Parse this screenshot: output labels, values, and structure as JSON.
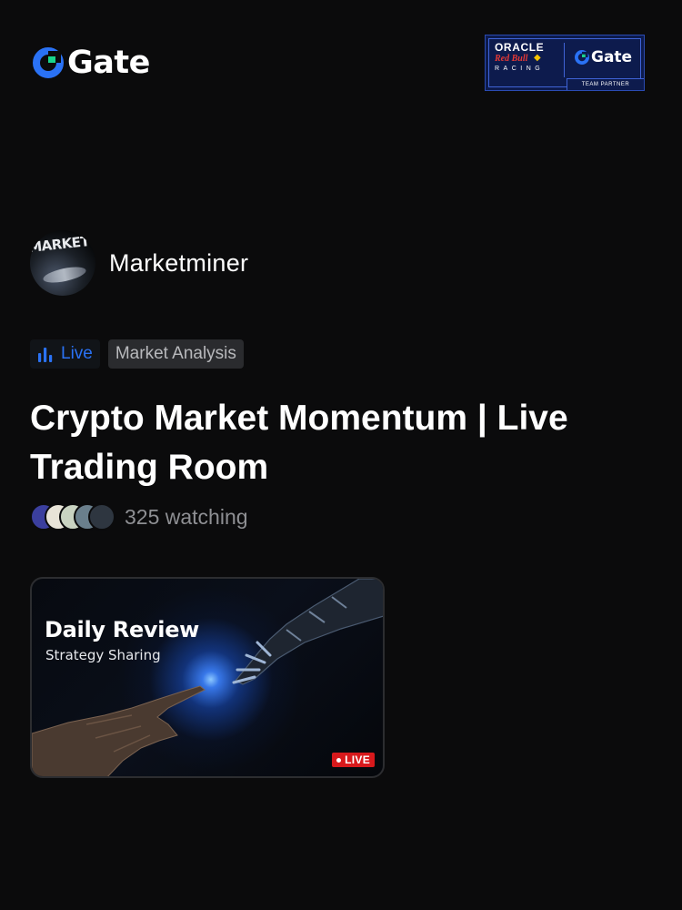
{
  "header": {
    "logo_text": "Gate",
    "partner": {
      "brand_line_1": "ORACLE",
      "brand_line_2": "Red Bull",
      "brand_line_3": "RACING",
      "gate_text": "Gate",
      "tag": "TEAM PARTNER"
    }
  },
  "streamer": {
    "avatar_text": "MARKET ANAL",
    "name": "Marketminer"
  },
  "tags": {
    "live_label": "Live",
    "category": "Market Analysis"
  },
  "stream": {
    "title": "Crypto Market Momentum | Live Trading Room",
    "viewers_text": "325 watching",
    "viewer_avatar_colors": [
      "#3b3f9e",
      "#e8e4d8",
      "#c9d3c1",
      "#6a7f8c",
      "#2e3640"
    ]
  },
  "card": {
    "title": "Daily Review",
    "subtitle": "Strategy Sharing",
    "live_badge": "LIVE"
  },
  "colors": {
    "background": "#0b0b0c",
    "brand_blue": "#2a72f5",
    "gate_green": "#19d48c",
    "live_red": "#d7191c"
  },
  "icons": {
    "logo": "gate-logo-icon",
    "live": "bar-chart-icon",
    "badge_dot": "live-dot-icon"
  }
}
